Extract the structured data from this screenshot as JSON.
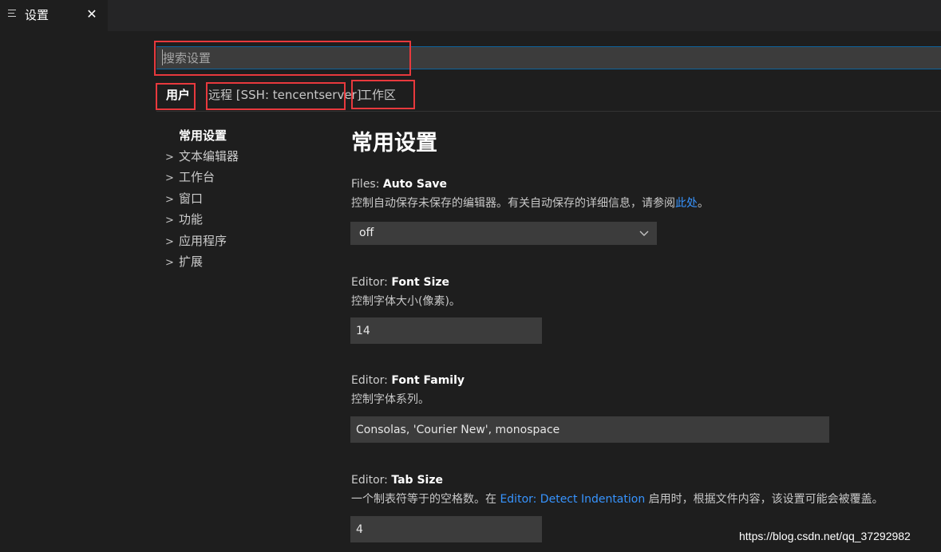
{
  "tab": {
    "title": "设置",
    "icon": "list-icon",
    "close": "✕"
  },
  "search": {
    "placeholder": "搜索设置",
    "value": ""
  },
  "scopes": {
    "user": "用户",
    "remote": "远程 [SSH: tencentserver]",
    "workspace": "工作区"
  },
  "toc": {
    "heading": "常用设置",
    "items": [
      "文本编辑器",
      "工作台",
      "窗口",
      "功能",
      "应用程序",
      "扩展"
    ]
  },
  "section_title": "常用设置",
  "settings": {
    "auto_save": {
      "category": "Files: ",
      "name": "Auto Save",
      "desc_before": "控制自动保存未保存的编辑器。有关自动保存的详细信息，请参阅",
      "desc_link": "此处",
      "desc_after": "。",
      "value": "off"
    },
    "font_size": {
      "category": "Editor: ",
      "name": "Font Size",
      "desc": "控制字体大小(像素)。",
      "value": "14"
    },
    "font_family": {
      "category": "Editor: ",
      "name": "Font Family",
      "desc": "控制字体系列。",
      "value": "Consolas, 'Courier New', monospace"
    },
    "tab_size": {
      "category": "Editor: ",
      "name": "Tab Size",
      "desc_before": "一个制表符等于的空格数。在 ",
      "desc_link": "Editor: Detect Indentation",
      "desc_after": " 启用时，根据文件内容，该设置可能会被覆盖。",
      "value": "4"
    }
  },
  "watermark": "https://blog.csdn.net/qq_37292982",
  "colors": {
    "highlight": "#e8393d",
    "link": "#3794ff",
    "background": "#1e1e1e"
  }
}
